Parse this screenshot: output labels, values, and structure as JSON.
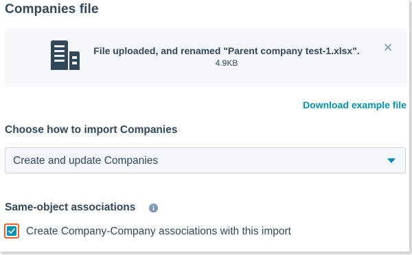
{
  "section": {
    "title": "Companies file"
  },
  "upload": {
    "message": "File uploaded, and renamed \"Parent company test-1.xlsx\".",
    "size": "4.9KB",
    "icon": "building-icon",
    "close_icon": "close-icon"
  },
  "links": {
    "download_example": "Download example file"
  },
  "import_mode": {
    "label": "Choose how to import Companies",
    "selected": "Create and update Companies",
    "caret_icon": "caret-down-icon"
  },
  "associations": {
    "label": "Same-object associations",
    "info_icon": "info-icon",
    "checkbox_label": "Create Company-Company associations with this import",
    "checked": true
  },
  "colors": {
    "text": "#33475b",
    "link": "#0091ae",
    "card_bg": "#f5f8fa",
    "highlight": "#e8612c"
  }
}
